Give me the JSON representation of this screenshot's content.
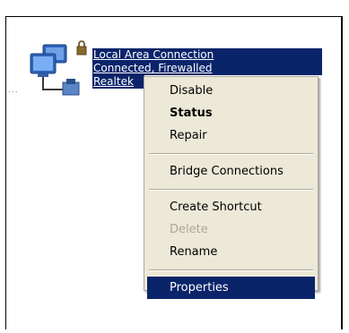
{
  "connection": {
    "name": "Local Area Connection",
    "status": "Connected, Firewalled",
    "device": "Realtek",
    "icon": "network-connection-icon"
  },
  "menu": {
    "items": [
      {
        "label": "Disable"
      },
      {
        "label": "Status"
      },
      {
        "label": "Repair"
      },
      {
        "label": "Bridge Connections"
      },
      {
        "label": "Create Shortcut"
      },
      {
        "label": "Delete"
      },
      {
        "label": "Rename"
      },
      {
        "label": "Properties"
      }
    ]
  },
  "colors": {
    "selection": "#0a246a",
    "menu_bg": "#ece9d8",
    "disabled_text": "#aca899"
  }
}
